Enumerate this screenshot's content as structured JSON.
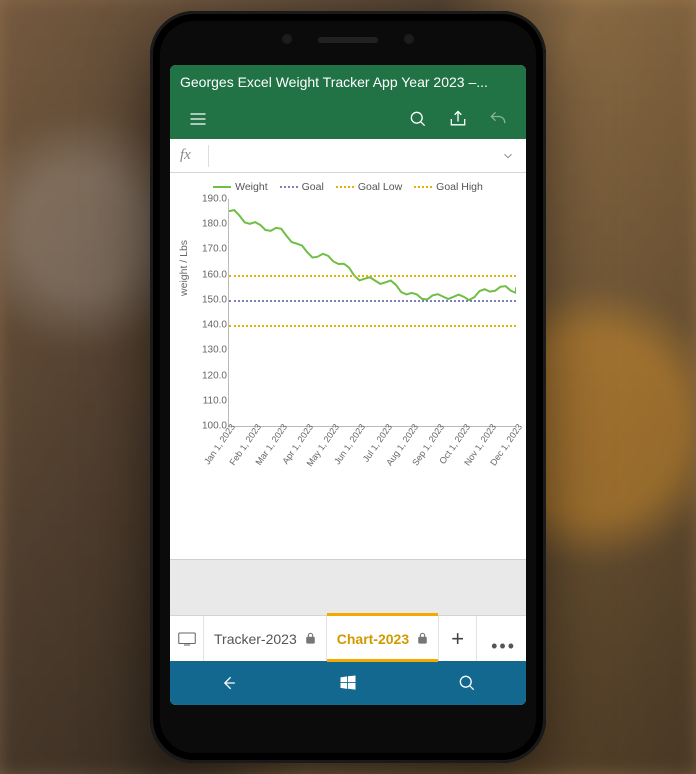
{
  "header": {
    "title": "Georges Excel Weight Tracker App Year 2023 –..."
  },
  "toolbar": {
    "menu_label": "Menu",
    "search_label": "Search",
    "share_label": "Share",
    "undo_label": "Undo"
  },
  "formula_bar": {
    "fx_label": "fx",
    "value": "",
    "expand_label": "Expand"
  },
  "tabs": {
    "items": [
      {
        "label": "Tracker-2023",
        "active": false,
        "locked": true
      },
      {
        "label": "Chart-2023",
        "active": true,
        "locked": true
      }
    ],
    "add_label": "+",
    "more_label": "•••",
    "present_label": "Present"
  },
  "navbar": {
    "back_label": "Back",
    "start_label": "Start",
    "search_label": "Search"
  },
  "colors": {
    "excel_green": "#217346",
    "accent_amber": "#f2a900",
    "nav_teal": "#13688f",
    "weight_line": "#6fbf44",
    "goal_line": "#7a7fbf",
    "goal_band": "#e0b400"
  },
  "chart_data": {
    "type": "line",
    "title": "",
    "xlabel": "",
    "ylabel": "weight / Lbs",
    "ylim": [
      100,
      190
    ],
    "yticks": [
      100,
      110,
      120,
      130,
      140,
      150,
      160,
      170,
      180,
      190
    ],
    "categories": [
      "Jan 1, 2023",
      "Feb 1, 2023",
      "Mar 1, 2023",
      "Apr 1, 2023",
      "May 1, 2023",
      "Jun 1, 2023",
      "Jul 1, 2023",
      "Aug 1, 2023",
      "Sep 1, 2023",
      "Oct 1, 2023",
      "Nov 1, 2023",
      "Dec 1, 2023"
    ],
    "reference_lines": {
      "Goal": 150,
      "Goal Low": 140,
      "Goal High": 160
    },
    "series": [
      {
        "name": "Weight",
        "style": "solid",
        "color": "#6fbf44",
        "values": [
          184,
          181,
          176,
          170,
          165,
          160,
          156,
          153,
          150,
          152,
          153,
          155
        ]
      },
      {
        "name": "Goal",
        "style": "dotted",
        "color": "#7a7fbf",
        "values": [
          150,
          150,
          150,
          150,
          150,
          150,
          150,
          150,
          150,
          150,
          150,
          150
        ]
      },
      {
        "name": "Goal Low",
        "style": "dotted",
        "color": "#e0b400",
        "values": [
          140,
          140,
          140,
          140,
          140,
          140,
          140,
          140,
          140,
          140,
          140,
          140
        ]
      },
      {
        "name": "Goal High",
        "style": "dotted",
        "color": "#e0b400",
        "values": [
          160,
          160,
          160,
          160,
          160,
          160,
          160,
          160,
          160,
          160,
          160,
          160
        ]
      }
    ],
    "legend": [
      "Weight",
      "Goal",
      "Goal Low",
      "Goal High"
    ]
  }
}
